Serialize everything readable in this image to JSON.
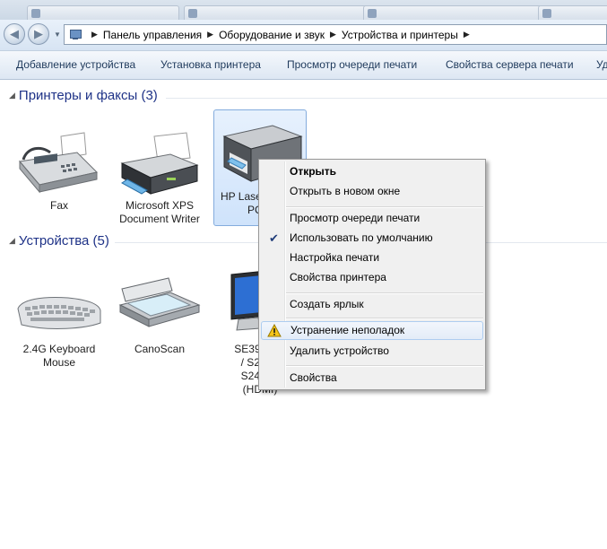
{
  "breadcrumb": [
    "Панель управления",
    "Оборудование и звук",
    "Устройства и принтеры"
  ],
  "commands": [
    "Добавление устройства",
    "Установка принтера",
    "Просмотр очереди печати",
    "Свойства сервера печати",
    "Уд"
  ],
  "groups": {
    "printers": "Принтеры и факсы (3)",
    "devices": "Устройства (5)"
  },
  "printers": [
    {
      "line1": "Fax",
      "line2": ""
    },
    {
      "line1": "Microsoft XPS",
      "line2": "Document Writer"
    },
    {
      "line1": "HP Lase",
      "line2": "PC"
    }
  ],
  "devices": [
    {
      "line1": "2.4G Keyboard",
      "line2": "Mouse"
    },
    {
      "line1": "CanoScan",
      "line2": ""
    },
    {
      "lines": [
        "SE390_S2",
        "/ S24E3",
        "S24E39",
        "(HDMI)"
      ]
    }
  ],
  "context_menu": {
    "open": "Открыть",
    "open_new_window": "Открыть в новом окне",
    "view_queue": "Просмотр очереди печати",
    "set_default": "Использовать по умолчанию",
    "print_settings": "Настройка печати",
    "printer_properties": "Свойства принтера",
    "create_shortcut": "Создать ярлык",
    "troubleshoot": "Устранение неполадок",
    "remove_device": "Удалить устройство",
    "properties": "Свойства"
  },
  "icons": {
    "back": "back-arrow-icon",
    "forward": "forward-arrow-icon",
    "check": "checkmark-icon",
    "warning": "warning-icon"
  },
  "colors": {
    "group_header": "#1e3287",
    "command_text": "#1e395b",
    "selection": "#cfe3fb"
  }
}
